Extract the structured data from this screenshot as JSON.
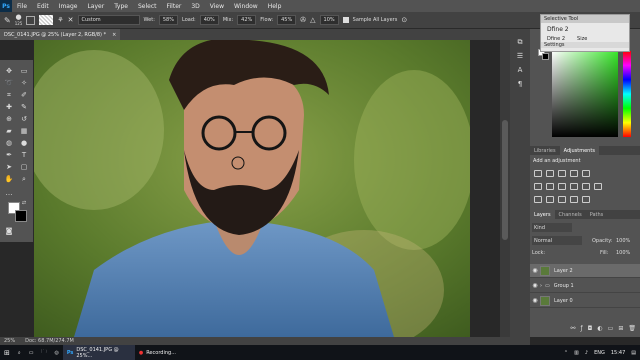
{
  "menubar": {
    "logo": "Ps",
    "items": [
      "File",
      "Edit",
      "Image",
      "Layer",
      "Type",
      "Select",
      "Filter",
      "3D",
      "View",
      "Window",
      "Help"
    ]
  },
  "options": {
    "brush_size": "125",
    "preset": "Custom",
    "wet_label": "Wet:",
    "wet": "58%",
    "load_label": "Load:",
    "load": "40%",
    "mix_label": "Mix:",
    "mix": "42%",
    "flow_label": "Flow:",
    "flow": "45%",
    "angle": "10%",
    "sample_all": "Sample All Layers"
  },
  "doc_tab": {
    "title": "DSC_0141.JPG @ 25% (Layer 2, RGB/8) *",
    "close": "×"
  },
  "status": {
    "zoom": "25%",
    "doc": "Doc: 68.7M/274.7M"
  },
  "selpop": {
    "title": "Selective Tool",
    "item1": "Dfine 2",
    "item2": "Dfine 2",
    "item3": "Size",
    "item4": "Settings"
  },
  "adjust": {
    "tabs": [
      "Libraries",
      "Adjustments"
    ],
    "add_label": "Add an adjustment"
  },
  "layers_panel": {
    "tabs": [
      "Layers",
      "Channels",
      "Paths"
    ],
    "kind": "Kind",
    "blend": "Normal",
    "opacity_label": "Opacity:",
    "opacity": "100%",
    "lock_label": "Lock:",
    "fill_label": "Fill:",
    "fill": "100%",
    "rows": [
      "Layer 2",
      "Group 1",
      "Layer 0"
    ]
  },
  "taskbar": {
    "app1": "DSC_0141.JPG @ 25%...",
    "app2": "Recording...",
    "lang": "ENG",
    "time": "15:47"
  },
  "colors": {
    "fg": "#ffffff",
    "bg": "#000000"
  }
}
